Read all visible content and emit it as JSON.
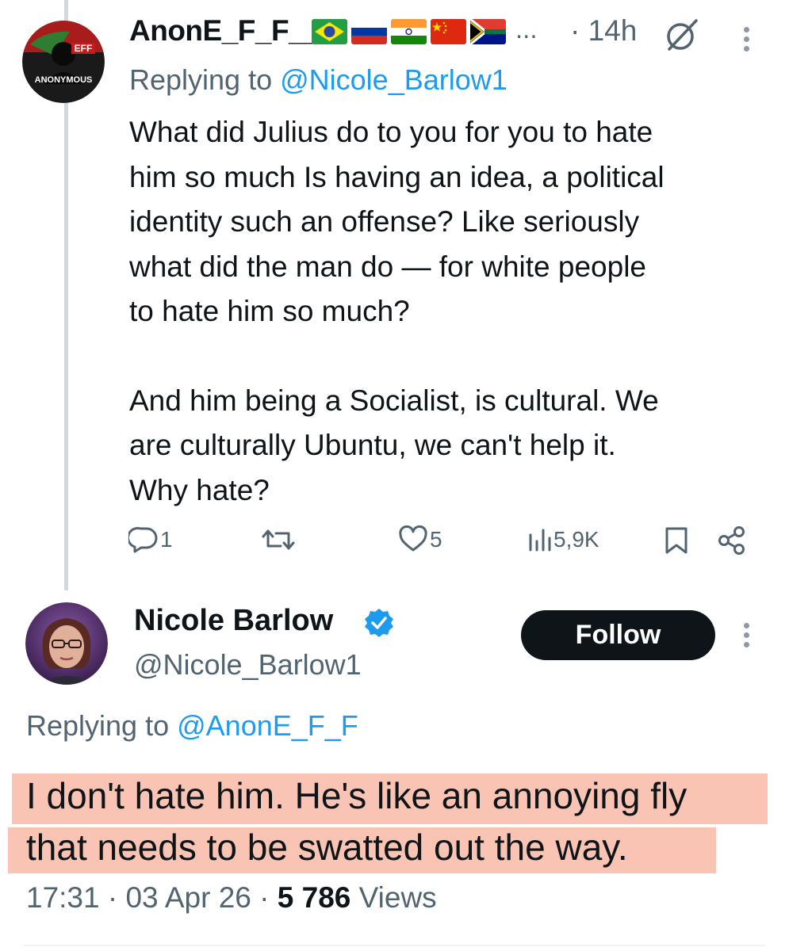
{
  "reply1": {
    "author_name": "AnonE_F_F__",
    "name_ellipsis": "...",
    "time": "· 14h",
    "avatar_text": "ANONYMOUS",
    "avatar_badge": "EFF",
    "flags": [
      "brazil-flag",
      "russia-flag",
      "india-flag",
      "china-flag",
      "south-africa-flag"
    ],
    "replying_prefix": "Replying to ",
    "replying_handle": "@Nicole_Barlow1",
    "paragraph1": [
      "What did Julius do to you for you to hate",
      "him so much Is having an idea, a political",
      "identity such an offense? Like seriously",
      "what did the man do — for white people",
      "to hate him so much?"
    ],
    "paragraph2": [
      "And him being a Socialist, is cultural. We",
      "are culturally Ubuntu, we can't help it.",
      "Why hate?"
    ],
    "actions": {
      "replies": "1",
      "reposts": "",
      "likes": "5",
      "views": "5,9K"
    }
  },
  "reply2": {
    "author_name": "Nicole Barlow",
    "handle": "@Nicole_Barlow1",
    "follow_label": "Follow",
    "replying_prefix": "Replying to ",
    "replying_handle": "@AnonE_F_F",
    "lines": [
      "I don't hate him. He's like an annoying fly",
      "that needs to be swatted out the way."
    ],
    "timestamp": "17:31 · 03 Apr 26 · ",
    "views_count": "5 786",
    "views_label": " Views"
  },
  "colors": {
    "text": "#0f1419",
    "secondary": "#536471",
    "link": "#1d9bf0",
    "highlight": "#f9c4b3",
    "verified": "#1d9bf0"
  }
}
